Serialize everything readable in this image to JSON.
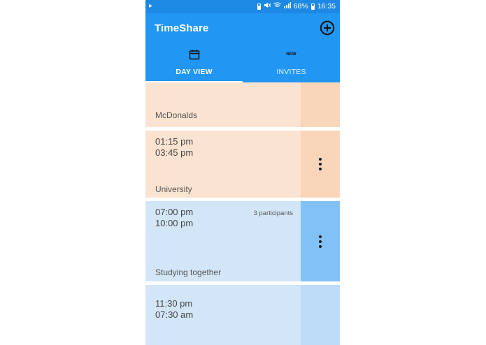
{
  "status_bar": {
    "battery_percent": "68%",
    "time": "16:35"
  },
  "app": {
    "title": "TimeShare"
  },
  "tabs": [
    {
      "label": "DAY VIEW",
      "icon": "calendar-icon",
      "selected": true
    },
    {
      "label": "INVITES",
      "icon": "new-badge-icon",
      "badge": "NEW",
      "selected": false
    }
  ],
  "events": [
    {
      "location": "McDonalds",
      "color": "orange"
    },
    {
      "start": "01:15 pm",
      "end": "03:45 pm",
      "location": "University",
      "color": "orange"
    },
    {
      "start": "07:00 pm",
      "end": "10:00 pm",
      "participants": "3 participants",
      "location": "Studying together",
      "color": "blue"
    },
    {
      "start": "11:30 pm",
      "end": "07:30 am",
      "color": "blue"
    }
  ],
  "colors": {
    "app_bar": "#2196F3",
    "status_bar": "#1E88E5",
    "orange_card": "#FBE3D2",
    "blue_card": "#D3E6F8",
    "blue_accent": "#82C1F5"
  }
}
